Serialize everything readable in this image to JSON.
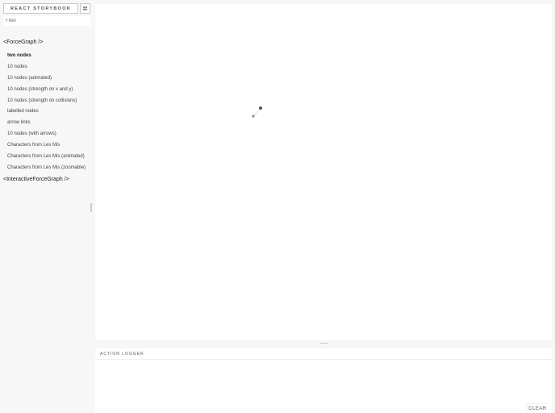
{
  "sidebar": {
    "brand": "REACT STORYBOOK",
    "shortcut": "⌘",
    "filter_placeholder": "Filter",
    "kinds": [
      {
        "name": "<ForceGraph />",
        "stories": [
          "two nodes",
          "10 nodes",
          "10 nodes (animated)",
          "10 nodes (strength on x and y)",
          "10 nodes (strength on collisions)",
          "labelled nodes",
          "arrow links",
          "10 nodes (with arrows)",
          "Characters from Les Mis",
          "Characters from Les Mis (animated)",
          "Characters from Les Mis (zoomable)"
        ],
        "selected_story_index": 0
      },
      {
        "name": "<InteractiveForceGraph />",
        "stories": []
      }
    ]
  },
  "preview": {
    "graph_nodes": [
      "node-a",
      "node-b"
    ],
    "node_color": "#555555",
    "link_color": "#999999"
  },
  "logger": {
    "title": "ACTION LOGGER",
    "clear_label": "CLEAR"
  }
}
